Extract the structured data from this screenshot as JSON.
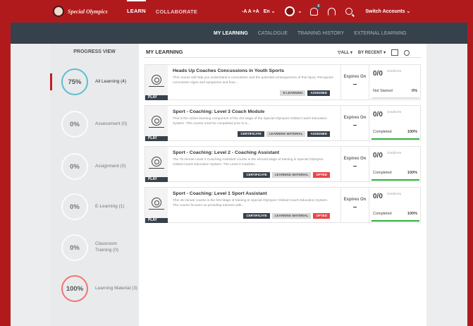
{
  "topbar": {
    "logo_text": "Special Olympics",
    "nav": [
      "LEARN",
      "COLLABORATE"
    ],
    "font_controls": "-A  A  +A",
    "language": "En ⌄",
    "notification_count": "0",
    "switch_accounts": "Switch Accounts ⌄"
  },
  "subnav": [
    "MY LEARNING",
    "CATALOGUE",
    "TRAINING HISTORY",
    "EXTERNAL LEARNING"
  ],
  "progress_view": {
    "title": "PROGRESS VIEW",
    "items": [
      {
        "pct": "75%",
        "label": "All Learning (4)"
      },
      {
        "pct": "0%",
        "label": "Assessment (0)"
      },
      {
        "pct": "0%",
        "label": "Assignment (0)"
      },
      {
        "pct": "0%",
        "label": "E-Learning (1)"
      },
      {
        "pct": "0%",
        "label": "Classroom Training (0)"
      },
      {
        "pct": "100%",
        "label": "Learning Material (3)"
      }
    ]
  },
  "main": {
    "title": "MY LEARNING",
    "filter_all": "ALL ▾",
    "filter_sort": "BY RECENT ▾",
    "cards": [
      {
        "play": "PLAY",
        "title": "Heads Up Coaches Concussions in Youth Sports",
        "desc": "This course will help you understand a concussion and the potential consequences of this injury. Recognize concussion signs and symptoms and how...",
        "tags": [
          "E-LEARNING",
          "ASSIGNED"
        ],
        "expires_label": "Expires On",
        "expires_value": "–",
        "credit": "0/0",
        "credit_label": "Credit Hrs",
        "status": "Not Started",
        "pct": "0%",
        "progress": 0
      },
      {
        "play": "PLAY",
        "title": "Sport - Coaching: Level 3 Coach Module",
        "desc": "This is the online learning component of the 3rd stage of the Special Olympics Global Coach Education System. This course must be completed prior to a...",
        "tags": [
          "CERTIFICATE",
          "LEARNING MATERIAL",
          "ASSIGNED"
        ],
        "expires_label": "Expires On",
        "expires_value": "–",
        "credit": "0/0",
        "credit_label": "Credit Hrs",
        "status": "Completed",
        "pct": "100%",
        "progress": 100
      },
      {
        "play": "PLAY",
        "title": "Sport - Coaching: Level 2 - Coaching Assistant",
        "desc": "The 75 minute Level 2 Coaching Assistant course is the second stage of training in Special Olympics Global Coach Education System. The Level 2 Coachin...",
        "tags": [
          "CERTIFICATE",
          "LEARNING MATERIAL",
          "OPTED"
        ],
        "expires_label": "Expires On",
        "expires_value": "–",
        "credit": "0/0",
        "credit_label": "Credit Hrs",
        "status": "Completed",
        "pct": "100%",
        "progress": 100
      },
      {
        "play": "PLAY",
        "title": "Sport - Coaching: Level 1 Sport Assistant",
        "desc": "This 45 minute course is the first stage of training in Special Olympics' Global Coach Education System. The course focuses on providing trainees with...",
        "tags": [
          "CERTIFICATE",
          "LEARNING MATERIAL",
          "OPTED"
        ],
        "expires_label": "Expires On",
        "expires_value": "–",
        "credit": "0/0",
        "credit_label": "Credit Hrs",
        "status": "Completed",
        "pct": "100%",
        "progress": 100
      }
    ]
  }
}
